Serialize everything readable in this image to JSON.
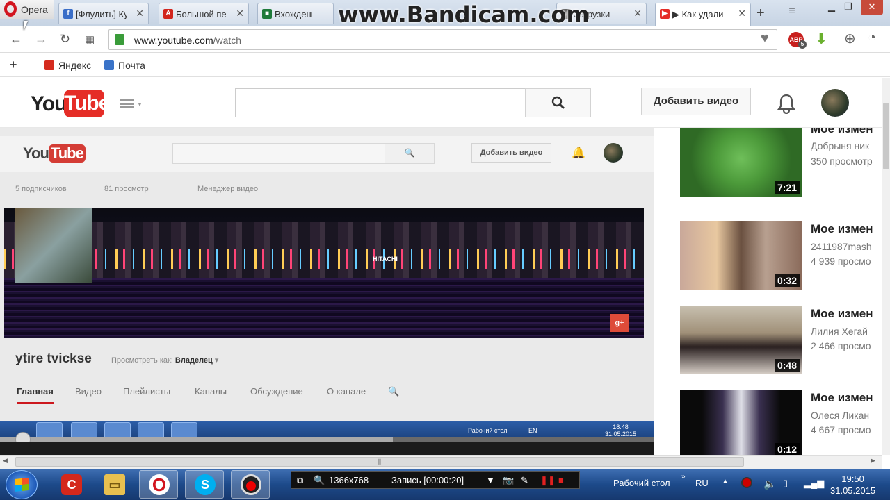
{
  "browser": {
    "menu_label": "Opera",
    "watermark": "www.Bandicam.com",
    "tabs": [
      {
        "label": "[Флудить] Ку",
        "fav_color": "#3a6ec8",
        "fav_letter": "f"
      },
      {
        "label": "Большой пер",
        "fav_color": "#d2261e",
        "fav_letter": "A"
      },
      {
        "label": "Вхождение",
        "fav_color": "#1f7a3a",
        "fav_letter": "■"
      },
      {
        "label": "Загрузки",
        "fav_color": "#666666",
        "fav_letter": "↓"
      },
      {
        "label": "▶ Как удали",
        "fav_color": "#e52d27",
        "fav_letter": "▶"
      }
    ],
    "url_prefix": "www.youtube.com",
    "url_path": "/watch",
    "bookmarks": [
      {
        "label": "Яндекс",
        "color": "#d52b1e"
      },
      {
        "label": "Почта",
        "color": "#3a73c8"
      }
    ],
    "ext_abp": "ABP",
    "ext_abp_count": "5"
  },
  "youtube": {
    "logo_you": "You",
    "logo_tube": "Tube",
    "upload_label": "Добавить видео",
    "search_placeholder": ""
  },
  "video": {
    "inner": {
      "upload_label": "Добавить видео",
      "subscribers": "5 подписчиков",
      "views": "81 просмотр",
      "manager": "Менеджер видео",
      "channel_name": "ytire tvickse",
      "view_as_label": "Просмотреть как:",
      "view_as_value": "Владелец",
      "banner_sign": "HITACHI",
      "gplus": "g+",
      "tabs": [
        "Главная",
        "Видео",
        "Плейлисты",
        "Каналы",
        "Обсуждение",
        "О канале"
      ],
      "taskbar_desktop": "Рабочий стол",
      "taskbar_lang": "EN",
      "taskbar_time": "18:48",
      "taskbar_date": "31.05.2015"
    },
    "progress_fraction": 0.035,
    "buffered_fraction": 0.6
  },
  "sidebar": {
    "items": [
      {
        "title": "Мое измен",
        "channel": "Добрыня ник",
        "views": "350 просмотр",
        "duration": "7:21"
      },
      {
        "title": "Мое измен",
        "channel": "2411987mash",
        "views": "4 939 просмо",
        "duration": "0:32"
      },
      {
        "title": "Мое измен",
        "channel": "Лилия Хегай",
        "views": "2 466 просмо",
        "duration": "0:48"
      },
      {
        "title": "Мое измен",
        "channel": "Олеся Ликан",
        "views": "4 667 просмо",
        "duration": "0:12"
      }
    ]
  },
  "bandicam": {
    "resolution": "1366x768",
    "record_status": "Запись [00:00:20]"
  },
  "taskbar": {
    "desktop_label": "Рабочий стол",
    "lang": "RU",
    "time": "19:50",
    "date": "31.05.2015"
  }
}
